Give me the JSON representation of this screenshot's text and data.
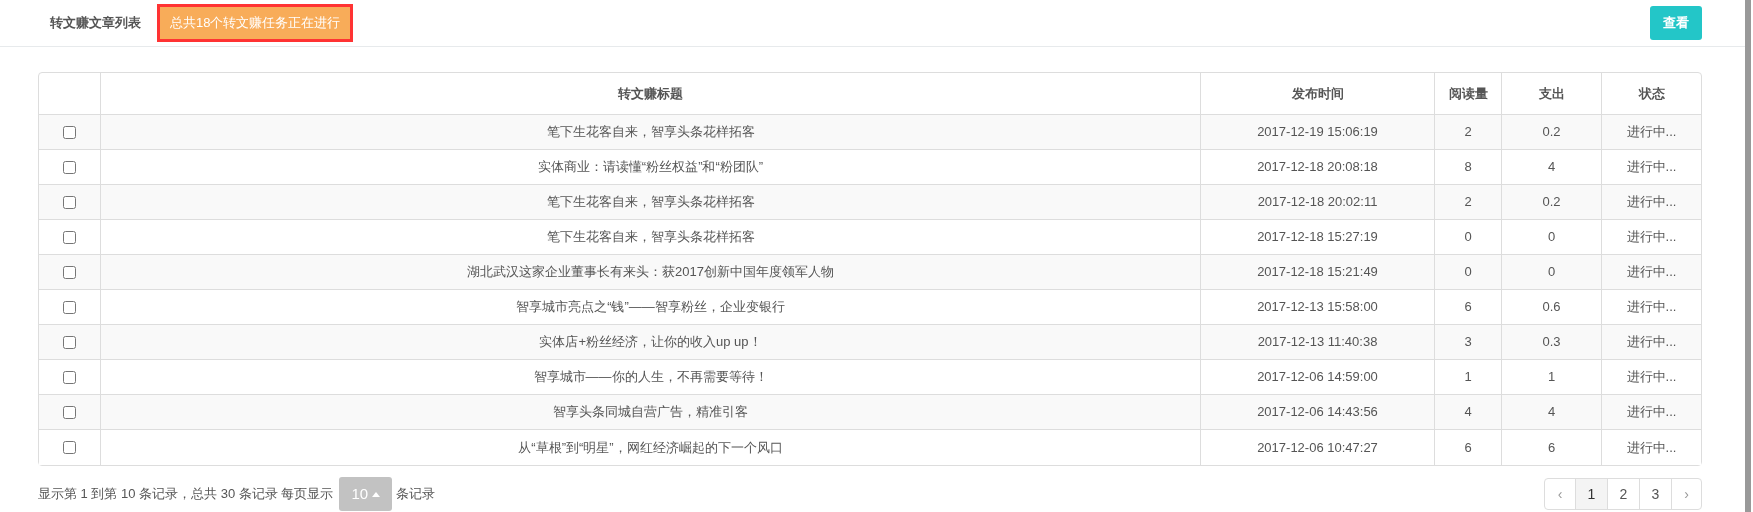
{
  "header": {
    "title": "转文赚文章列表",
    "notice": "总共18个转文赚任务正在进行",
    "view_button": "查看"
  },
  "table": {
    "columns": [
      "转文赚标题",
      "发布时间",
      "阅读量",
      "支出",
      "状态"
    ],
    "rows": [
      {
        "checked": false,
        "title": "笔下生花客自来，智享头条花样拓客",
        "time": "2017-12-19 15:06:19",
        "reads": "2",
        "cost": "0.2",
        "status": "进行中..."
      },
      {
        "checked": false,
        "title": "实体商业：请读懂“粉丝权益”和“粉团队”",
        "time": "2017-12-18 20:08:18",
        "reads": "8",
        "cost": "4",
        "status": "进行中..."
      },
      {
        "checked": false,
        "title": "笔下生花客自来，智享头条花样拓客",
        "time": "2017-12-18 20:02:11",
        "reads": "2",
        "cost": "0.2",
        "status": "进行中..."
      },
      {
        "checked": false,
        "title": "笔下生花客自来，智享头条花样拓客",
        "time": "2017-12-18 15:27:19",
        "reads": "0",
        "cost": "0",
        "status": "进行中..."
      },
      {
        "checked": false,
        "title": "湖北武汉这家企业董事长有来头：获2017创新中国年度领军人物",
        "time": "2017-12-18 15:21:49",
        "reads": "0",
        "cost": "0",
        "status": "进行中..."
      },
      {
        "checked": false,
        "title": "智享城市亮点之“钱”——智享粉丝，企业变银行",
        "time": "2017-12-13 15:58:00",
        "reads": "6",
        "cost": "0.6",
        "status": "进行中..."
      },
      {
        "checked": false,
        "title": "实体店+粉丝经济，让你的收入up up！",
        "time": "2017-12-13 11:40:38",
        "reads": "3",
        "cost": "0.3",
        "status": "进行中..."
      },
      {
        "checked": false,
        "title": "智享城市——你的人生，不再需要等待！",
        "time": "2017-12-06 14:59:00",
        "reads": "1",
        "cost": "1",
        "status": "进行中..."
      },
      {
        "checked": false,
        "title": "智享头条同城自营广告，精准引客",
        "time": "2017-12-06 14:43:56",
        "reads": "4",
        "cost": "4",
        "status": "进行中..."
      },
      {
        "checked": false,
        "title": "从“草根”到“明星”，网红经济崛起的下一个风口",
        "time": "2017-12-06 10:47:27",
        "reads": "6",
        "cost": "6",
        "status": "进行中..."
      }
    ]
  },
  "footer": {
    "summary": "显示第 1 到第 10 条记录，总共 30 条记录 每页显示",
    "page_size": "10",
    "suffix": "条记录"
  },
  "pagination": {
    "prev": "‹",
    "pages": [
      {
        "label": "1",
        "selected": true
      },
      {
        "label": "2",
        "selected": false
      },
      {
        "label": "3",
        "selected": false
      }
    ],
    "next": "›"
  }
}
